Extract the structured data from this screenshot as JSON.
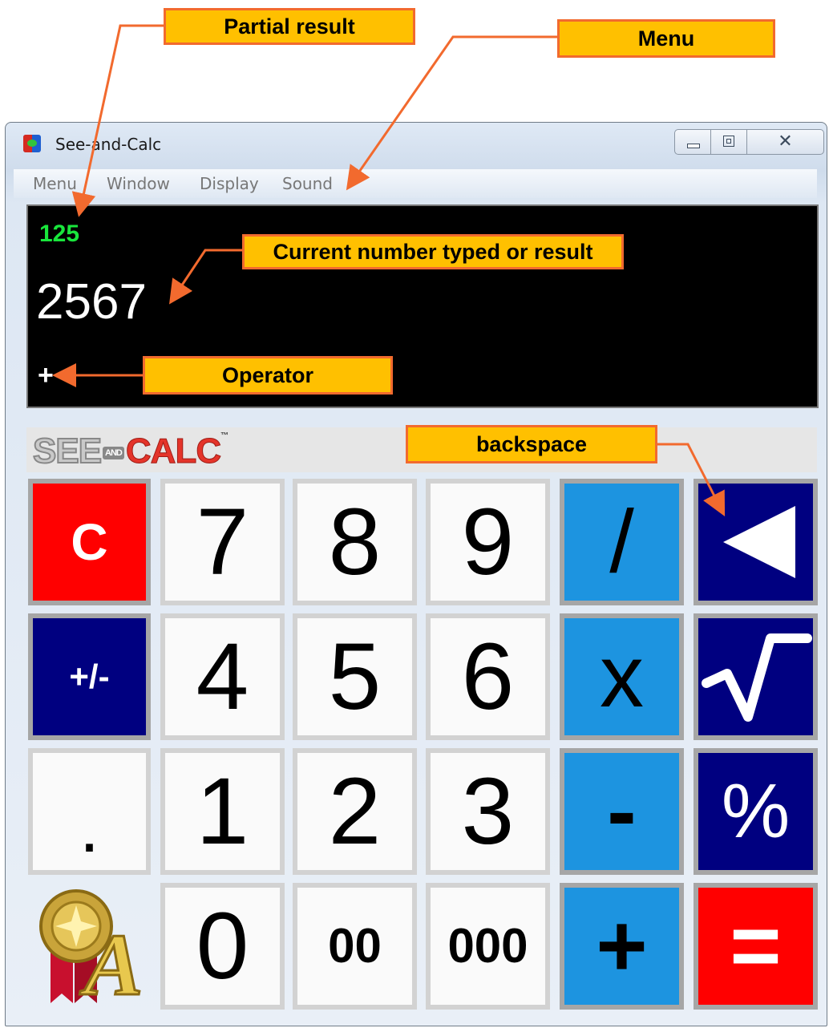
{
  "window": {
    "title": "See-and-Calc",
    "close_glyph": "✕"
  },
  "menu": [
    "Menu",
    "Window",
    "Display",
    "Sound"
  ],
  "display": {
    "partial_result": "125",
    "current_value": "2567",
    "operator": "+"
  },
  "logo": {
    "see": "SEE",
    "and": "AND",
    "calc": "CALC",
    "tm": "™"
  },
  "keys": {
    "clear": "C",
    "seven": "7",
    "eight": "8",
    "nine": "9",
    "divide": "/",
    "backspace_icon": "backspace-triangle-icon",
    "negate": "+/-",
    "four": "4",
    "five": "5",
    "six": "6",
    "multiply": "x",
    "sqrt_icon": "square-root-icon",
    "decimal": ".",
    "one": "1",
    "two": "2",
    "three": "3",
    "subtract": "-",
    "percent": "%",
    "award_icon": "award-medal-icon",
    "zero": "0",
    "double_zero": "00",
    "triple_zero": "000",
    "add": "+",
    "equals": "="
  },
  "annotations": {
    "partial_result": "Partial result",
    "menu": "Menu",
    "current": "Current number typed or result",
    "operator": "Operator",
    "backspace": "backspace"
  },
  "colors": {
    "accent_orange": "#f26a2e",
    "callout_fill": "#ffc000",
    "key_red": "#ff0000",
    "key_navy": "#000080",
    "key_blue": "#1d94e0",
    "partial_green": "#19e63c"
  }
}
